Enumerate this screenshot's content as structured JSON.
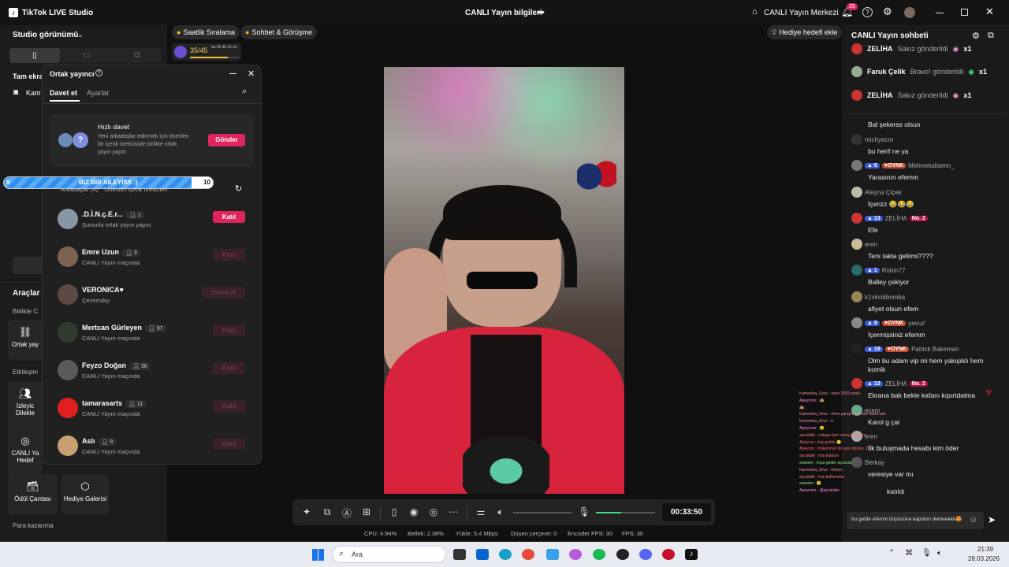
{
  "app": {
    "title": "TikTok LIVE Studio",
    "center_title": "CANLI Yayın bilgileri",
    "live_center": "CANLI Yayın Merkezi",
    "notif_count": "26"
  },
  "left": {
    "studio_view": "Studio görünümü",
    "fullscreen": "Tam ekra",
    "camera": "Kam",
    "tools_title": "Araçlar",
    "together": "Birlikte C",
    "interaction": "Etkileşim",
    "tools": [
      {
        "label": "Ortak yay",
        "icon": "link-icon"
      },
      {
        "label": "İzleyic Dilekle",
        "icon": "people-icon"
      },
      {
        "label": "CANLI Ya Hedef",
        "icon": "target-icon"
      },
      {
        "label": "Ödül Çantası",
        "icon": "bag-icon"
      },
      {
        "label": "Hediye Galerisi",
        "icon": "gift-icon"
      }
    ],
    "earn": "Para kazanma"
  },
  "top_pills": {
    "hourly": "Saatlik Sıralama",
    "chat": "Sohbet & Görüşme",
    "progress": "35/45",
    "timer": "sa 26 dk 15 sn",
    "gift_goal": "Hediye hedefi ekle"
  },
  "modal": {
    "title": "Ortak yayıncı",
    "tab_invite": "Davet et",
    "tab_settings": "Ayarlar",
    "quick_title": "Hızlı davet",
    "quick_desc": "Yeni arkadaşlar edinmek için önerilen bir içerik üreticisiyle birlikte ortak yayın yapın",
    "send": "Gönder",
    "subtabs": "Arkadaşlar (4)    Önerilen içerik üreticileri",
    "rows": [
      {
        "name": ".D.İ.N.ç.E.r...",
        "count": "1",
        "sub": "Şununla ortak yayın yapın:",
        "btn": "Katıl",
        "active": true
      },
      {
        "name": "Emre Uzun",
        "count": "3",
        "sub": "CANLI Yayın maçında",
        "btn": "Katıl",
        "active": false
      },
      {
        "name": "VERONICA♥",
        "count": "",
        "sub": "Çevrimdışı",
        "btn": "Davet et",
        "active": false
      },
      {
        "name": "Mertcan Gürleyen",
        "count": "97",
        "sub": "CANLI Yayın maçında",
        "btn": "Katıl",
        "active": false
      },
      {
        "name": "Feyzo Doğan",
        "count": "36",
        "sub": "CANLI Yayın maçında",
        "btn": "Katıl",
        "active": false
      },
      {
        "name": "tamarasarts",
        "count": "11",
        "sub": "CANLI Yayın maçında",
        "btn": "Katıl",
        "active": false
      },
      {
        "name": "Aslı",
        "count": "9",
        "sub": "CANLI Yayın maçında",
        "btn": "Katıl",
        "active": false
      }
    ]
  },
  "banner": {
    "left": "9",
    "text": "BIZ BIR AILEYISS :)",
    "right": "10"
  },
  "controls": {
    "timer": "00:33:50"
  },
  "stats": {
    "cpu": "CPU: 4.94%",
    "mem": "Bellek: 2.38%",
    "upload": "Yükle: 5.4 Mbps",
    "drop": "Düşen çerçeve: 0",
    "enc": "Encoder FPS: 30",
    "fps": "FPS: 30"
  },
  "chat": {
    "title": "CANLI Yayın sohbeti",
    "gifts": [
      {
        "user": "ZELİHA",
        "text": "Sakız gönderildi",
        "mult": "x1"
      },
      {
        "user": "Faruk Çelik",
        "text": "Bravo! gönderildi",
        "mult": "x1"
      },
      {
        "user": "ZELİHA",
        "text": "Sakız gönderildi",
        "mult": "x1"
      }
    ],
    "messages": [
      {
        "user": "",
        "lvl": "",
        "oynk": false,
        "no2": false,
        "msg": "Bal şekerss olsun"
      },
      {
        "user": "michyecrn",
        "lvl": "",
        "oynk": false,
        "no2": false,
        "msg": "bu herif ne ya"
      },
      {
        "user": "Mehmetalisenn_",
        "lvl": "5",
        "oynk": true,
        "no2": false,
        "msg": "Yarasının efemm"
      },
      {
        "user": "Aleyna Çiçek",
        "lvl": "",
        "oynk": false,
        "no2": false,
        "msg": "İçerizz 😂😂😂"
      },
      {
        "user": "ZELİHA",
        "lvl": "13",
        "oynk": false,
        "no2": true,
        "msg": "Efe"
      },
      {
        "user": "eren",
        "lvl": "",
        "oynk": false,
        "no2": false,
        "msg": "Ters takla gelirmi????"
      },
      {
        "user": "Robin77",
        "lvl": "1",
        "oynk": false,
        "no2": false,
        "msg": "Balley çekiyor"
      },
      {
        "user": "k1vircikbomba",
        "lvl": "",
        "oynk": false,
        "no2": false,
        "msg": "afiyet olsun efem"
      },
      {
        "user": "yavuz'",
        "lvl": "9",
        "oynk": true,
        "no2": false,
        "msg": "İçermişsiniz efemm"
      },
      {
        "user": "Patrick Bakeman",
        "lvl": "19",
        "oynk": true,
        "no2": false,
        "msg": "Olm bu adam vip mi hem yakışıklı hem komik"
      },
      {
        "user": "ZELİHA",
        "lvl": "13",
        "oynk": false,
        "no2": true,
        "msg": "Ekrana bak bekle kafanı kıpırtdatma"
      },
      {
        "user": "ecem",
        "lvl": "",
        "oynk": false,
        "no2": false,
        "msg": "Karol g çal"
      },
      {
        "user": "eren",
        "lvl": "",
        "oynk": false,
        "no2": false,
        "msg": "İlk buluşmada hesabı kim öder"
      },
      {
        "user": "Berkay",
        "lvl": "",
        "oynk": false,
        "no2": false,
        "msg": "veresiye var mı"
      },
      {
        "user": "",
        "lvl": "",
        "oynk": false,
        "no2": false,
        "msg": "katıldı"
      }
    ],
    "input_text": "bu gelde efemin büyüsüne kapıldın demeekkk😍"
  },
  "overlay_chat": [
    "Kamenlsa_Gnur : sene 2009 sanki",
    "Apeyronn : 🙈",
    "🙈 : ",
    "Kamenlsa_Gnur : efem pareyn bulması masa almış",
    "Kamenlsa_Gnur : b",
    "Apeyronn : 😮",
    "aycalatte : nokayo ben nereye düştüm",
    "Apeyron : hoş geldin 🙂",
    "Apeyron : mükemmel bir yere düştün :D",
    "aycalatte : hoş buldum",
    "ssanem : hoşa geldin aycasss",
    "Kamenlsa_Gnur : eleyen",
    "aycalatte : hoş bulfummm",
    "ssanem : 😊",
    "Apeyronn : @aycalatte"
  ],
  "taskbar": {
    "search": "Ara",
    "time": "21:39",
    "date": "28.03.2026"
  }
}
